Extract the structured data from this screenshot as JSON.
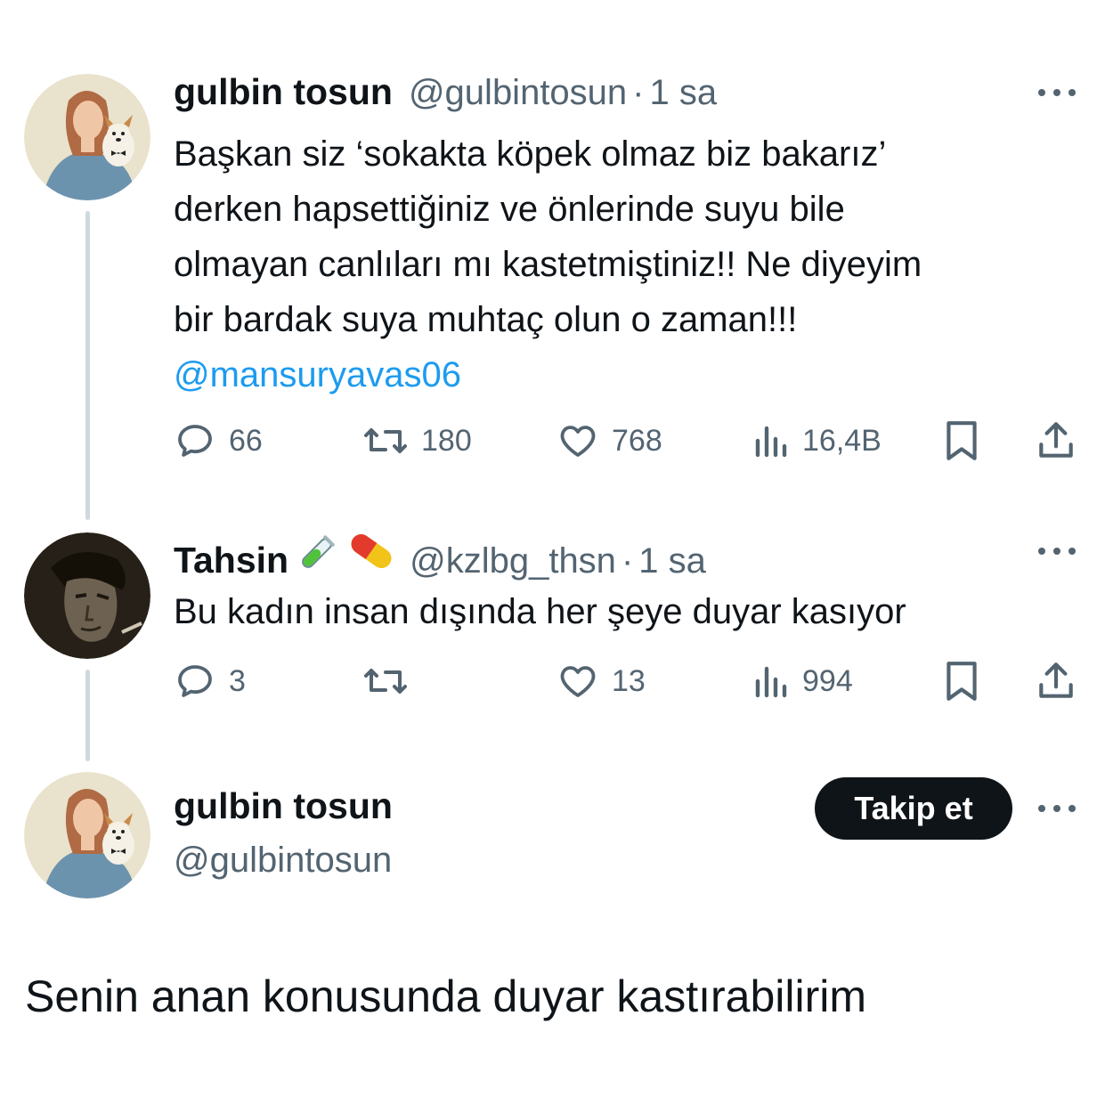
{
  "tweet1": {
    "name": "gulbin tosun",
    "handle": "@gulbintosun",
    "separator": "·",
    "time": "1 sa",
    "lines": [
      "Başkan siz ‘sokakta köpek olmaz biz bakarız’",
      "derken hapsettiğiniz ve önlerinde suyu bile",
      "olmayan canlıları mı kastetmiştiniz!!  Ne diyeyim",
      "bir bardak suya muhtaç olun o zaman!!!"
    ],
    "mention": "@mansuryavas06",
    "replies": "66",
    "retweets": "180",
    "likes": "768",
    "views": "16,4B"
  },
  "tweet2": {
    "name": "Tahsin",
    "emoji_icons": [
      "test-tube-icon",
      "pill-icon"
    ],
    "handle": "@kzlbg_thsn",
    "separator": "·",
    "time": "1 sa",
    "text": "Bu kadın insan dışında her şeye duyar kasıyor",
    "replies": "3",
    "retweets": "",
    "likes": "13",
    "views": "994"
  },
  "reply": {
    "name": "gulbin tosun",
    "handle": "@gulbintosun",
    "follow_label": "Takip et",
    "text": "Senin anan konusunda duyar kastırabilirim"
  },
  "colors": {
    "text": "#0f1419",
    "secondary": "#536471",
    "link": "#1d9bf0",
    "thread_line": "#cfd9de",
    "button_bg": "#0f1419"
  }
}
